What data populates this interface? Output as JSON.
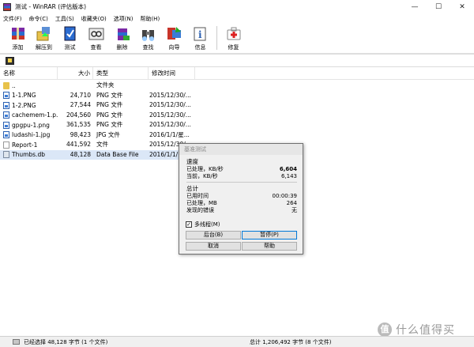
{
  "window": {
    "title": "测试 - WinRAR (评估版本)",
    "buttons": [
      "—",
      "☐",
      "✕"
    ]
  },
  "menu": [
    "文件(F)",
    "命令(C)",
    "工具(S)",
    "收藏夹(O)",
    "选项(N)",
    "帮助(H)"
  ],
  "toolbar": [
    {
      "label": "添加",
      "icon": "add-archive-icon"
    },
    {
      "label": "解压到",
      "icon": "extract-icon"
    },
    {
      "label": "测试",
      "icon": "test-icon"
    },
    {
      "label": "查看",
      "icon": "view-icon"
    },
    {
      "label": "删除",
      "icon": "delete-icon"
    },
    {
      "label": "查找",
      "icon": "find-icon"
    },
    {
      "label": "向导",
      "icon": "wizard-icon"
    },
    {
      "label": "信息",
      "icon": "info-icon"
    },
    {
      "label": "修复",
      "icon": "repair-icon"
    }
  ],
  "columns": {
    "name": "名称",
    "size": "大小",
    "type": "类型",
    "date": "修改时间"
  },
  "files": [
    {
      "name": "..",
      "size": "",
      "type": "文件夹",
      "date": "",
      "icon": "folder"
    },
    {
      "name": "1-1.PNG",
      "size": "24,710",
      "type": "PNG 文件",
      "date": "2015/12/30/...",
      "icon": "img"
    },
    {
      "name": "1-2.PNG",
      "size": "27,544",
      "type": "PNG 文件",
      "date": "2015/12/30/...",
      "icon": "img"
    },
    {
      "name": "cachemem-1.p...",
      "size": "204,560",
      "type": "PNG 文件",
      "date": "2015/12/30/...",
      "icon": "img"
    },
    {
      "name": "gpgpu-1.png",
      "size": "361,535",
      "type": "PNG 文件",
      "date": "2015/12/30/...",
      "icon": "img"
    },
    {
      "name": "ludashi-1.jpg",
      "size": "98,423",
      "type": "JPG 文件",
      "date": "2016/1/1/星...",
      "icon": "img"
    },
    {
      "name": "Report-1",
      "size": "441,592",
      "type": "文件",
      "date": "2015/12/30/...",
      "icon": "file"
    },
    {
      "name": "Thumbs.db",
      "size": "48,128",
      "type": "Data Base File",
      "date": "2016/1/1/...",
      "icon": "db",
      "selected": true
    }
  ],
  "status": {
    "left": "已经选择 48,128 字节 (1 个文件)",
    "right": "总计 1,206,492 字节 (8 个文件)"
  },
  "dialog": {
    "title": "基准测试",
    "speed_header": "速度",
    "processed_label": "已处理，KB/秒",
    "processed_value": "6,604",
    "current_label": "当前，KB/秒",
    "current_value": "6,143",
    "total_header": "总计",
    "elapsed_label": "已用时间",
    "elapsed_value": "00:00:39",
    "processed_mb_label": "已处理，MB",
    "processed_mb_value": "264",
    "errors_label": "发现的错误",
    "errors_value": "无",
    "multithread_label": "多线程(M)",
    "multithread_checked": true,
    "background_button": "后台(B)",
    "pause_button": "暂停(P)",
    "cancel_button": "取消",
    "help_button": "帮助"
  },
  "watermark": {
    "logo": "值",
    "text": "什么值得买"
  }
}
